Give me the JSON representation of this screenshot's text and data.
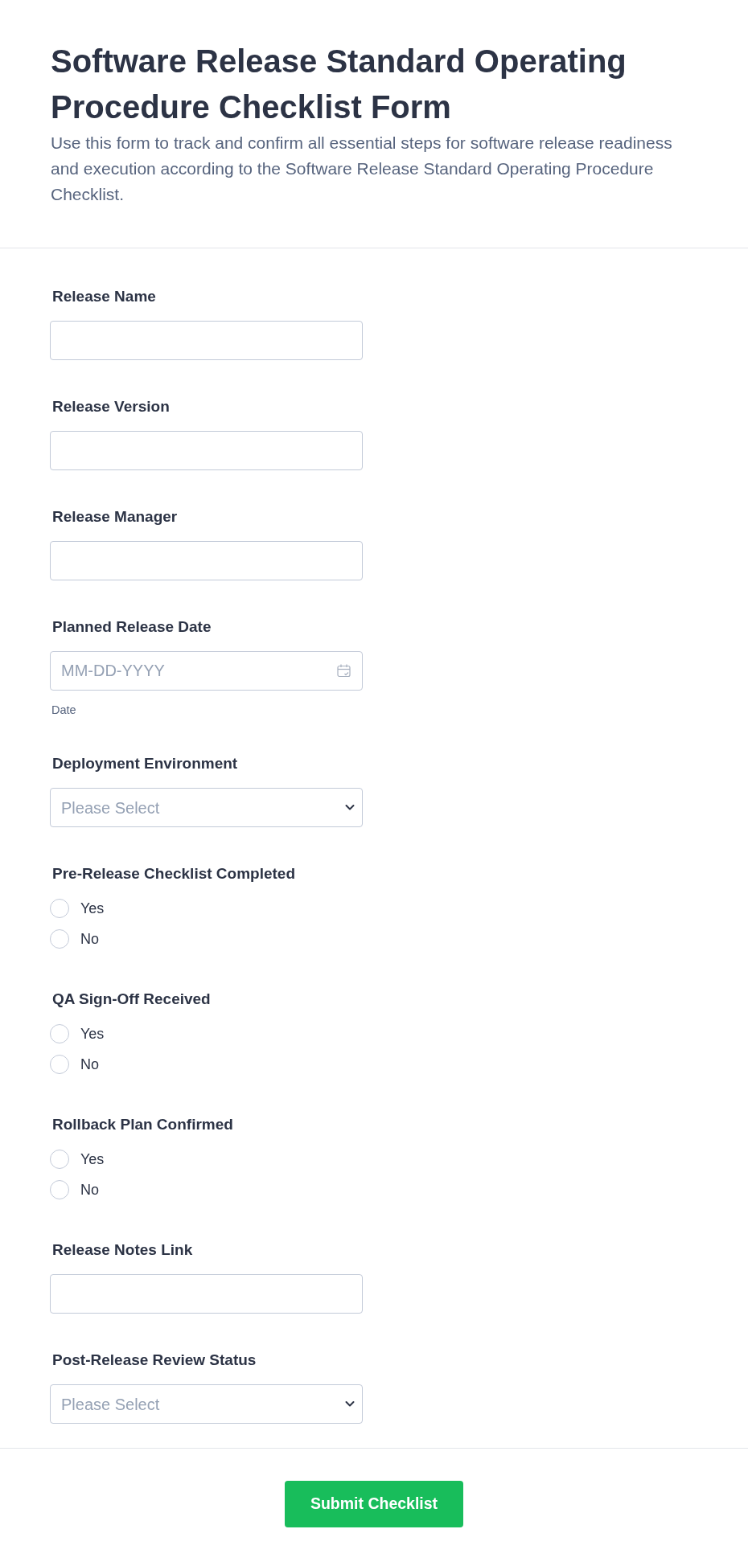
{
  "header": {
    "title": "Software Release Standard Operating Procedure Checklist Form",
    "description": "Use this form to track and confirm all essential steps for software release readiness and execution according to the Software Release Standard Operating Procedure Checklist."
  },
  "fields": [
    {
      "kind": "text",
      "label": "Release Name"
    },
    {
      "kind": "text",
      "label": "Release Version"
    },
    {
      "kind": "text",
      "label": "Release Manager"
    },
    {
      "kind": "date",
      "label": "Planned Release Date",
      "placeholder": "MM-DD-YYYY",
      "sublabel": "Date"
    },
    {
      "kind": "select",
      "label": "Deployment Environment",
      "placeholder": "Please Select"
    },
    {
      "kind": "radio",
      "label": "Pre-Release Checklist Completed",
      "options": [
        {
          "label": "Yes",
          "selected": false
        },
        {
          "label": "No",
          "selected": false
        }
      ]
    },
    {
      "kind": "radio",
      "label": "QA Sign-Off Received",
      "options": [
        {
          "label": "Yes",
          "selected": false
        },
        {
          "label": "No",
          "selected": false
        }
      ]
    },
    {
      "kind": "radio",
      "label": "Rollback Plan Confirmed",
      "options": [
        {
          "label": "Yes",
          "selected": false
        },
        {
          "label": "No",
          "selected": false
        }
      ]
    },
    {
      "kind": "text",
      "label": "Release Notes Link"
    },
    {
      "kind": "select",
      "label": "Post-Release Review Status",
      "placeholder": "Please Select"
    }
  ],
  "submit_button": {
    "label": "Submit Checklist"
  }
}
